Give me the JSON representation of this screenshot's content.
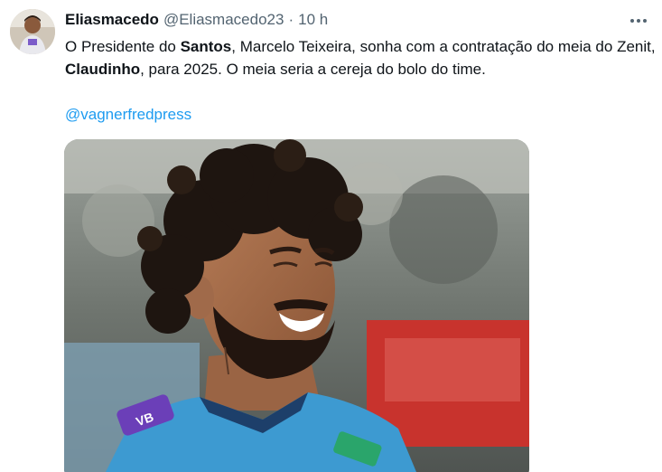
{
  "tweet": {
    "display_name": "Eliasmacedo",
    "handle": "@Eliasmacedo23",
    "separator": "·",
    "time": "10 h",
    "text": {
      "line1_a": "O Presidente do ",
      "line1_bold": "Santos",
      "line1_b": ", Marcelo Teixeira, sonha com a contratação do meia do Zenit, ",
      "line2_bold": "Claudinho",
      "line2_b": ", para 2025. O meia seria a cereja do bolo do time."
    },
    "mention": "@vagnerfredpress",
    "media_jersey_text": "VB"
  },
  "icons": {
    "more": "more-horizontal-icon"
  },
  "colors": {
    "text": "#0f1419",
    "secondary": "#536471",
    "link": "#1d9bf0",
    "jersey": "#3d9ad1"
  }
}
